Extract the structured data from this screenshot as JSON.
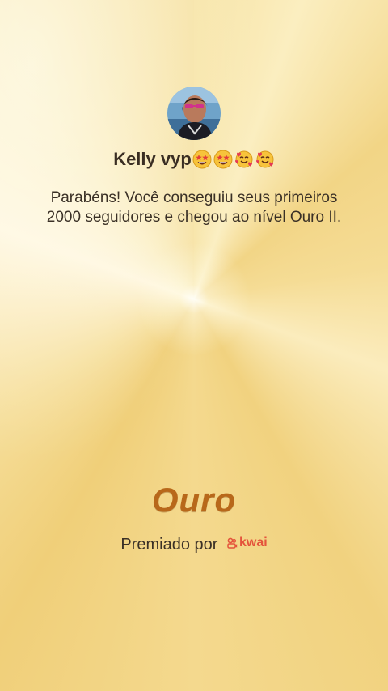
{
  "profile": {
    "avatar_icon": "user-photo-avatar",
    "username": "Kelly vyp",
    "username_emojis": [
      "star-struck-emoji",
      "star-struck-emoji",
      "smiling-face-with-hearts-emoji",
      "smiling-face-with-hearts-emoji"
    ]
  },
  "achievement": {
    "message": "Parabéns! Você conseguiu seus primeiros 2000 seguidores e chegou ao nível Ouro II.",
    "level_title": "Ouro"
  },
  "footer": {
    "awarded_by": "Premiado por",
    "brand_name": "kwai",
    "brand_icon": "kwai-logo-icon",
    "brand_color": "#e4543c"
  },
  "colors": {
    "background": "#f3d98a",
    "level_title": "#b8681a",
    "text": "#3a3026"
  }
}
